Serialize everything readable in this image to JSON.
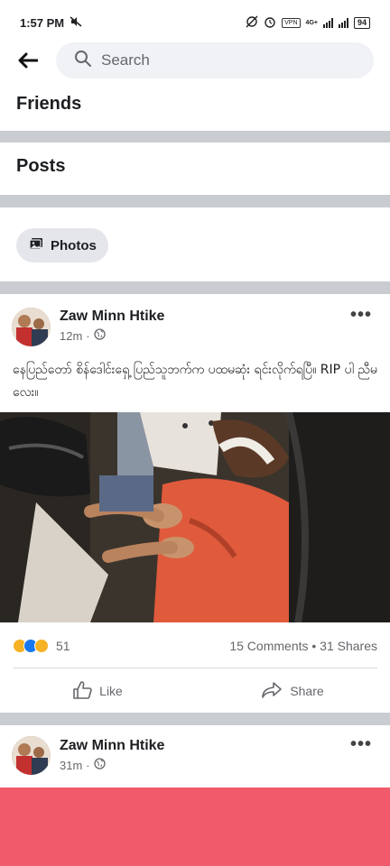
{
  "status_bar": {
    "time": "1:57 PM",
    "network": "4G+",
    "vpn_label": "VPN",
    "battery": "94"
  },
  "search": {
    "placeholder": "Search"
  },
  "sections": {
    "friends": "Friends",
    "posts": "Posts",
    "photos_chip": "Photos"
  },
  "posts": [
    {
      "author": "Zaw Minn Htike",
      "time": "12m",
      "privacy_icon": "globe-icon",
      "text": "နေပြည်တော် စိန်ဒေါင်းရှေ့ ပြည်သူဘက်က ပထမဆုံး ရင်းလိုက်ရပြီ။ RIP ပါ ညီမလေး။",
      "reactions_count": "51",
      "reactions": [
        "sad",
        "like",
        "wow"
      ],
      "comments_shares": "15 Comments • 31 Shares",
      "like_label": "Like",
      "share_label": "Share"
    },
    {
      "author": "Zaw Minn Htike",
      "time": "31m",
      "privacy_icon": "globe-icon"
    }
  ],
  "colors": {
    "separator": "#c9ccd1",
    "banner": "#f05a6a",
    "secondary_text": "#65676b"
  }
}
